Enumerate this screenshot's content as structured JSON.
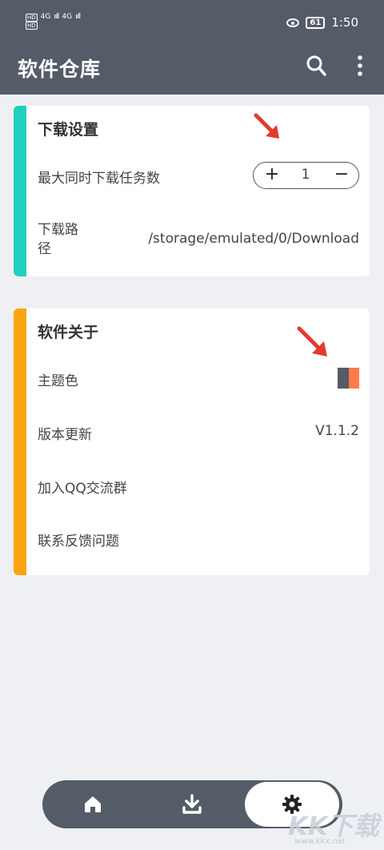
{
  "status_bar": {
    "hd1": "HD",
    "hd2": "HD",
    "net1": "4G",
    "net2": "4G",
    "signal": "ııll",
    "battery": "61",
    "time": "1:50"
  },
  "app_bar": {
    "title": "软件仓库"
  },
  "download_settings": {
    "title": "下载设置",
    "max_tasks_label": "最大同时下载任务数",
    "stepper_value": "1",
    "plus": "+",
    "minus": "−",
    "path_label_line1": "下载路",
    "path_label_line2": "径",
    "path_value": "/storage/emulated/0/Download",
    "accent": "#1fcfbf"
  },
  "about": {
    "title": "软件关于",
    "theme_label": "主题色",
    "version_label": "版本更新",
    "version_value": "V1.1.2",
    "qq_label": "加入QQ交流群",
    "feedback_label": "联系反馈问题",
    "accent": "#f9a30e"
  },
  "theme_colors": [
    "#545c68",
    "#ff7a4a"
  ],
  "bottom_nav": {
    "items": [
      {
        "icon": "home-icon"
      },
      {
        "icon": "download-icon"
      },
      {
        "icon": "gear-icon",
        "active": true
      }
    ]
  },
  "watermark": {
    "text": "KK下载",
    "url": "www.kkx.net"
  }
}
